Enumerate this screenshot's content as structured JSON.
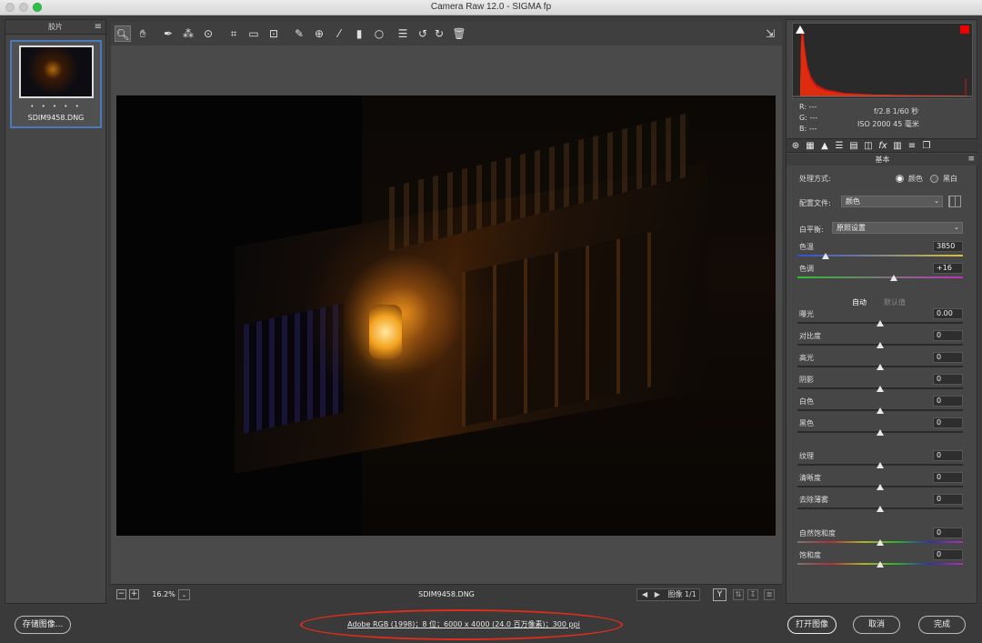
{
  "window": {
    "title": "Camera Raw 12.0 -  SIGMA fp"
  },
  "filmstrip": {
    "header": "胶片",
    "menu_icon": "menu-icon",
    "thumb_dots": "• • • • •",
    "thumb_name": "SDIM9458.DNG"
  },
  "toolbar": {
    "tools": [
      "zoom-tool",
      "hand-tool",
      "white-balance-tool",
      "color-sampler-tool",
      "targeted-adjustment-tool",
      "crop-tool",
      "straighten-tool",
      "transform-tool",
      "spot-removal-tool",
      "red-eye-tool",
      "adjustment-brush-tool",
      "graduated-filter-tool",
      "radial-filter-tool",
      "preferences-tool",
      "rotate-ccw-tool",
      "rotate-cw-tool",
      "trash-tool"
    ],
    "fullscreen_icon": "fullscreen-icon"
  },
  "statusbar": {
    "zoom": "16.2%",
    "filename": "SDIM9458.DNG",
    "image_counter": "图像 1/1",
    "y_button": "Y"
  },
  "readout": {
    "r": "R:  ---",
    "g": "G:  ---",
    "b": "B:  ---",
    "aperture_shutter": "f/2.8   1/60 秒",
    "iso_focal": "ISO 2000   45 毫米"
  },
  "panel": {
    "section_title": "基本",
    "treatment_label": "处理方式:",
    "treatment_color": "颜色",
    "treatment_bw": "黑白",
    "profile_label": "配置文件:",
    "profile_value": "颜色",
    "wb_label": "白平衡:",
    "wb_value": "原照设置",
    "auto": "自动",
    "default": "默认值",
    "sliders": [
      {
        "label": "色温",
        "value": "3850",
        "pos": 0.17
      },
      {
        "label": "色调",
        "value": "+16",
        "pos": 0.58
      },
      {
        "label": "曝光",
        "value": "0.00",
        "pos": 0.5
      },
      {
        "label": "对比度",
        "value": "0",
        "pos": 0.5
      },
      {
        "label": "高光",
        "value": "0",
        "pos": 0.5
      },
      {
        "label": "阴影",
        "value": "0",
        "pos": 0.5
      },
      {
        "label": "白色",
        "value": "0",
        "pos": 0.5
      },
      {
        "label": "黑色",
        "value": "0",
        "pos": 0.5
      },
      {
        "label": "纹理",
        "value": "0",
        "pos": 0.5
      },
      {
        "label": "清晰度",
        "value": "0",
        "pos": 0.5
      },
      {
        "label": "去除薄雾",
        "value": "0",
        "pos": 0.5
      },
      {
        "label": "自然饱和度",
        "value": "0",
        "pos": 0.5
      },
      {
        "label": "饱和度",
        "value": "0",
        "pos": 0.5
      }
    ]
  },
  "bottom": {
    "save_button": "存储图像...",
    "workflow_link": "Adobe RGB (1998)；8 位；6000 x 4000 (24.0 百万像素)；300 ppi",
    "open_button": "打开图像",
    "cancel_button": "取消",
    "done_button": "完成"
  },
  "colors": {
    "highlight_oval": "#e02c1a",
    "selection": "#4a79c0"
  }
}
